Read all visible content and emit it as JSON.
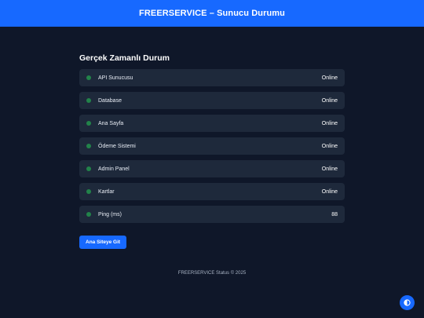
{
  "header": {
    "title": "FREERSERVICE – Sunucu Durumu"
  },
  "main": {
    "section_title": "Gerçek Zamanlı Durum",
    "services": [
      {
        "name": "API Sunucusu",
        "status": "Online"
      },
      {
        "name": "Database",
        "status": "Online"
      },
      {
        "name": "Ana Sayfa",
        "status": "Online"
      },
      {
        "name": "Ödeme Sistemi",
        "status": "Online"
      },
      {
        "name": "Admin Panel",
        "status": "Online"
      },
      {
        "name": "Kartlar",
        "status": "Online"
      },
      {
        "name": "Ping (ms)",
        "status": "88"
      }
    ],
    "home_button_label": "Ana Siteye Git"
  },
  "footer": {
    "text": "FREERSERVICE Status © 2025"
  },
  "theme_toggle": {
    "icon": "half-circle-contrast-icon"
  },
  "colors": {
    "background": "#0f1729",
    "accent": "#1769ff",
    "card": "#1e293b",
    "status_dot": "#22834a"
  }
}
